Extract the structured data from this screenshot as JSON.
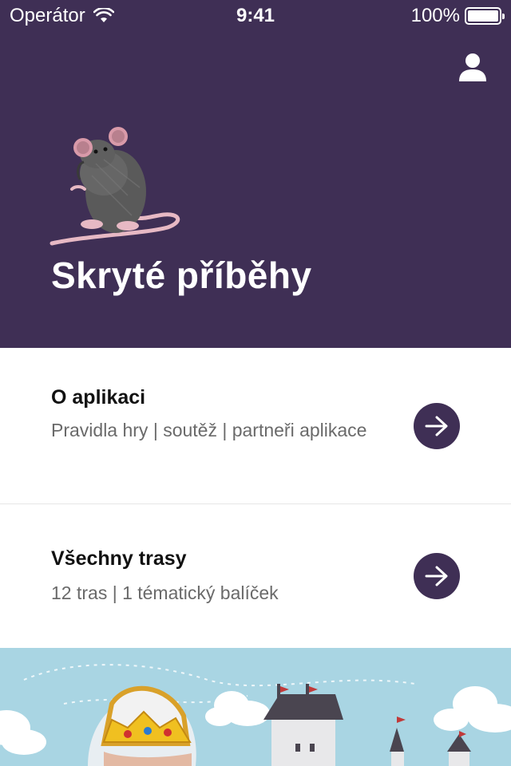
{
  "status_bar": {
    "carrier": "Operátor",
    "time": "9:41",
    "battery": "100%"
  },
  "header": {
    "title": "Skryté příběhy",
    "profile_icon": "user-icon"
  },
  "menu": [
    {
      "title": "O aplikaci",
      "subtitle": "Pravidla hry | soutěž | partneři aplikace",
      "icon": "arrow-right-icon"
    },
    {
      "title": "Všechny trasy",
      "subtitle": "12 tras | 1 tématický balíček",
      "icon": "arrow-right-icon"
    }
  ],
  "colors": {
    "brand": "#3f2f55",
    "sky": "#a9d5e3"
  }
}
